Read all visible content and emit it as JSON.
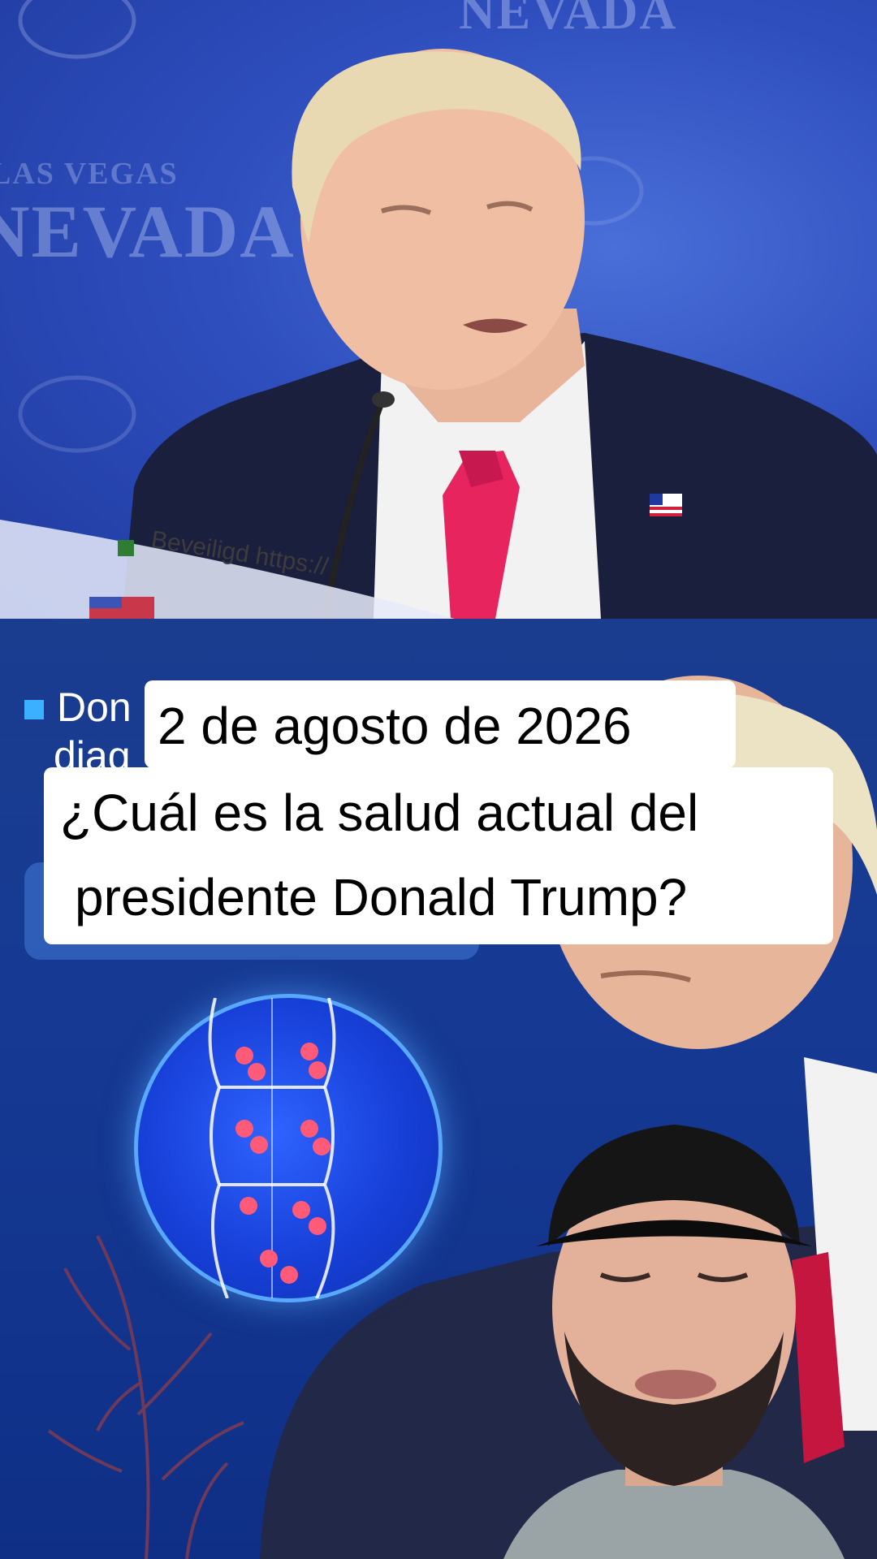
{
  "top": {
    "backdrop_text_large": "NEVADA",
    "backdrop_text_small": "LAS VEGAS",
    "backdrop_text_top": "NEVADA",
    "browser_fragment": "Beveiligd  https://"
  },
  "bottom": {
    "overlay_label": "Don",
    "overlay_label_line2": "diag"
  },
  "caption": {
    "date": "2 de agosto de 2026",
    "line1": "¿Cuál es la salud actual del",
    "line2": "presidente Donald Trump?"
  },
  "colors": {
    "top_backdrop": "#2f4fbf",
    "bottom_backdrop": "#163a94",
    "tie": "#e8245e",
    "suit": "#1a1f3d",
    "accent_blue": "#58a8ff",
    "clot": "#ff5a78"
  }
}
